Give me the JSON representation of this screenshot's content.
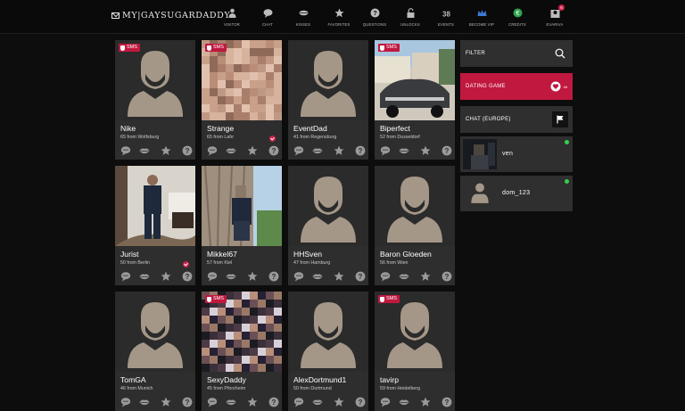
{
  "brand": {
    "name": "MY|GAYSUGARDADDY"
  },
  "nav": [
    {
      "label": "VISITOR",
      "icon": "person-icon"
    },
    {
      "label": "CHAT",
      "icon": "chat-bubble-icon"
    },
    {
      "label": "KISSES",
      "icon": "lips-icon"
    },
    {
      "label": "FAVORITES",
      "icon": "star-icon"
    },
    {
      "label": "QUESTIONS",
      "icon": "question-icon"
    },
    {
      "label": "UNLOCKS",
      "icon": "padlock-icon"
    },
    {
      "label": "EVENTS",
      "icon": "calendar-icon"
    },
    {
      "label": "BECOME VIP",
      "icon": "crown-icon"
    },
    {
      "label": "CREDITS",
      "icon": "coin-icon"
    },
    {
      "label": "EVARIVA",
      "icon": "user-avatar-icon",
      "badge": "6"
    }
  ],
  "cards": [
    {
      "name": "Nike",
      "sub": "65 from Wolfsburg",
      "sms": "SMS",
      "photo": "silhouette",
      "verified": false
    },
    {
      "name": "Strange",
      "sub": "65 from Lahr",
      "sms": "SMS",
      "photo": "pix-skin",
      "verified": true
    },
    {
      "name": "EventDad",
      "sub": "41 from Regensburg",
      "sms": "",
      "photo": "silhouette",
      "verified": false
    },
    {
      "name": "Biperfect",
      "sub": "52 from Dusseldorf",
      "sms": "SMS",
      "photo": "car",
      "verified": false
    },
    {
      "name": "Jurist",
      "sub": "50 from Berlin",
      "sms": "",
      "photo": "suit",
      "verified": true
    },
    {
      "name": "Mikkel67",
      "sub": "57 from Kiel",
      "sms": "",
      "photo": "tree",
      "verified": false
    },
    {
      "name": "HHSven",
      "sub": "47 from Hamburg",
      "sms": "",
      "photo": "silhouette",
      "verified": false
    },
    {
      "name": "Baron Gloeden",
      "sub": "56 from Wien",
      "sms": "",
      "photo": "silhouette",
      "verified": false
    },
    {
      "name": "TomGA",
      "sub": "46 from Munich",
      "sms": "",
      "photo": "silhouette",
      "verified": false
    },
    {
      "name": "SexyDaddy",
      "sub": "45 from Pforzheim",
      "sms": "SMS",
      "photo": "pix-dark",
      "verified": false
    },
    {
      "name": "AlexDortmund1",
      "sub": "50 from Dortmund",
      "sms": "",
      "photo": "silhouette",
      "verified": false
    },
    {
      "name": "tavirp",
      "sub": "59 from Heidelberg",
      "sms": "SMS",
      "photo": "silhouette",
      "verified": false
    }
  ],
  "card_actions": [
    "chat-bubble-icon",
    "lips-icon",
    "star-icon",
    "question-icon"
  ],
  "sidebar": {
    "filter": {
      "label": "FILTER",
      "icon": "search-icon"
    },
    "dating_game": {
      "label": "DATING GAME",
      "icon": "heart-icon",
      "count": "48"
    },
    "chat": {
      "label": "CHAT (EUROPE)",
      "icon": "flag-icon"
    },
    "online_users": [
      {
        "name": "ven",
        "online": true
      },
      {
        "name": "dom_123",
        "online": true
      }
    ]
  },
  "colors": {
    "accent": "#c0183f",
    "background": "#0d0d0d",
    "card": "#2e2e2e",
    "silhouette": "#a49788",
    "online": "#35d04a"
  }
}
